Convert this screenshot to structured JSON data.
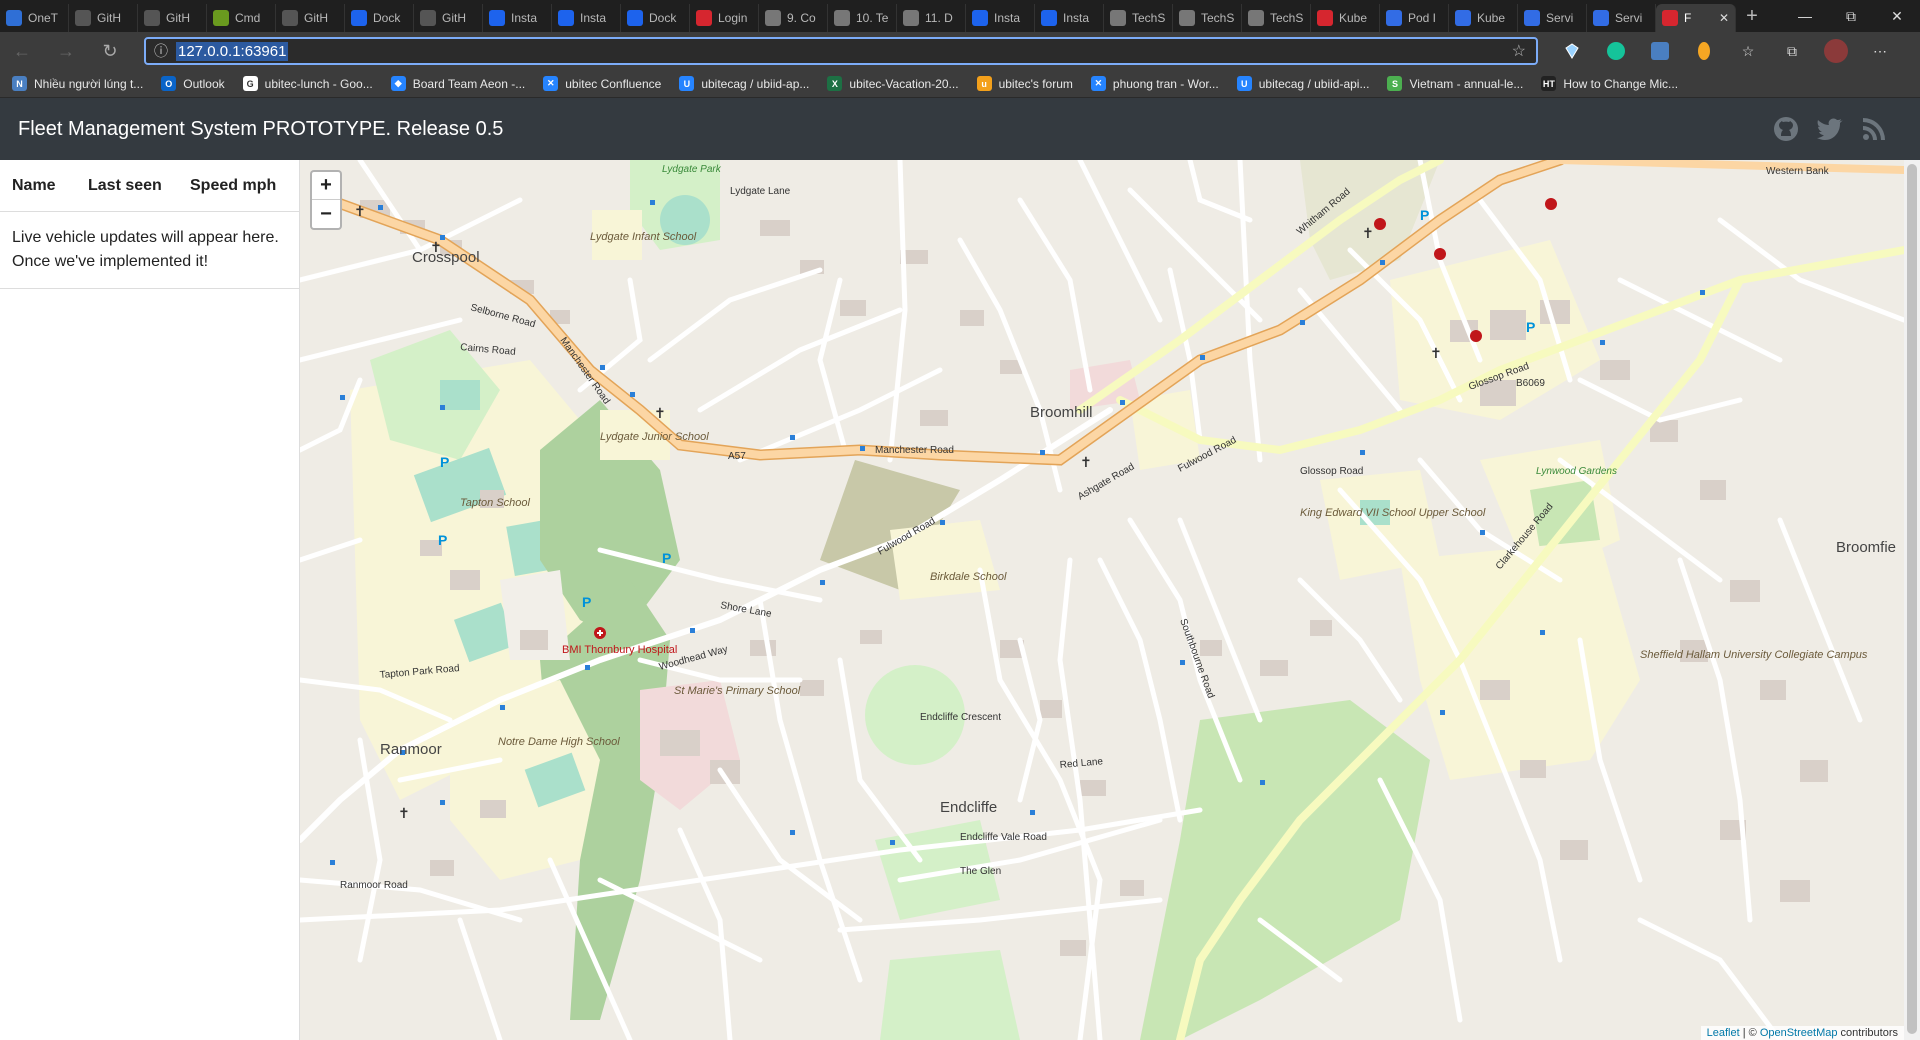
{
  "browser": {
    "tabs": [
      {
        "label": "OneT",
        "color": "#2f6fd6"
      },
      {
        "label": "GitH",
        "color": "#555555"
      },
      {
        "label": "GitH",
        "color": "#555555"
      },
      {
        "label": "Cmd",
        "color": "#6a9a1f"
      },
      {
        "label": "GitH",
        "color": "#555555"
      },
      {
        "label": "Dock",
        "color": "#1d63ed"
      },
      {
        "label": "GitH",
        "color": "#555555"
      },
      {
        "label": "Insta",
        "color": "#1d63ed"
      },
      {
        "label": "Insta",
        "color": "#1d63ed"
      },
      {
        "label": "Dock",
        "color": "#1d63ed"
      },
      {
        "label": "Login",
        "color": "#d6262f"
      },
      {
        "label": "9. Co",
        "color": "#777777"
      },
      {
        "label": "10. Te",
        "color": "#777777"
      },
      {
        "label": "11. D",
        "color": "#777777"
      },
      {
        "label": "Insta",
        "color": "#1d63ed"
      },
      {
        "label": "Insta",
        "color": "#1d63ed"
      },
      {
        "label": "TechS",
        "color": "#777777"
      },
      {
        "label": "TechS",
        "color": "#777777"
      },
      {
        "label": "TechS",
        "color": "#777777"
      },
      {
        "label": "Kube",
        "color": "#d6262f"
      },
      {
        "label": "Pod I",
        "color": "#326ce5"
      },
      {
        "label": "Kube",
        "color": "#326ce5"
      },
      {
        "label": "Servi",
        "color": "#326ce5"
      },
      {
        "label": "Servi",
        "color": "#326ce5"
      }
    ],
    "active_tab": {
      "label": "F",
      "color": "#d6262f"
    },
    "new_tab_label": "+",
    "url": "127.0.0.1:63961",
    "bookmarks": [
      {
        "label": "Nhiều người lúng t...",
        "color": "#4a7fc1",
        "glyph": "N"
      },
      {
        "label": "Outlook",
        "color": "#0a64c8",
        "glyph": "O"
      },
      {
        "label": "ubitec-lunch - Goo...",
        "color": "#ffffff",
        "glyph": "G"
      },
      {
        "label": "Board Team Aeon -...",
        "color": "#2684ff",
        "glyph": "◆"
      },
      {
        "label": "ubitec Confluence",
        "color": "#2684ff",
        "glyph": "✕"
      },
      {
        "label": "ubitecag / ubiid-ap...",
        "color": "#2684ff",
        "glyph": "U"
      },
      {
        "label": "ubitec-Vacation-20...",
        "color": "#1d7044",
        "glyph": "X"
      },
      {
        "label": "ubitec's forum",
        "color": "#f3a01b",
        "glyph": "u"
      },
      {
        "label": "phuong tran - Wor...",
        "color": "#2684ff",
        "glyph": "✕"
      },
      {
        "label": "ubitecag / ubiid-api...",
        "color": "#2684ff",
        "glyph": "U"
      },
      {
        "label": "Vietnam - annual-le...",
        "color": "#4caf50",
        "glyph": "S"
      },
      {
        "label": "How to Change Mic...",
        "color": "#222222",
        "glyph": "HT"
      }
    ]
  },
  "app": {
    "title": "Fleet Management System PROTOTYPE. Release 0.5",
    "table": {
      "headers": [
        "Name",
        "Last seen",
        "Speed mph"
      ],
      "placeholder": "Live vehicle updates will appear here. Once we've implemented it!"
    },
    "map": {
      "zoom_in": "+",
      "zoom_out": "−",
      "attribution_leaflet": "Leaflet",
      "attribution_sep": " | © ",
      "attribution_osm": "OpenStreetMap",
      "attribution_suffix": " contributors",
      "labels": {
        "crosspool": "Crosspool",
        "broomhill": "Broomhill",
        "ranmoor": "Ranmoor",
        "endcliffe": "Endcliffe",
        "broomfie": "Broomfie",
        "manchester_road": "Manchester Road",
        "manchester_road2": "Manchester Road",
        "a57": "A57",
        "fulwood_road": "Fulwood Road",
        "fulwood_road2": "Fulwood Road",
        "glossop_road": "Glossop Road",
        "glossop_road2": "Glossop Road",
        "clarkehouse_road": "Clarkehouse Road",
        "whitham_road": "Whitham Road",
        "b6069": "B6069",
        "lydgate_lane": "Lydgate Lane",
        "tapton_school": "Tapton School",
        "lydgate_junior": "Lydgate Junior School",
        "lydgate_infant": "Lydgate Infant School",
        "notre_dame": "Notre Dame High School",
        "birkdale": "Birkdale School",
        "st_maries": "St Marie's Primary School",
        "king_edward": "King Edward VII School Upper School",
        "sheffield_hallam": "Sheffield Hallam University Collegiate Campus",
        "bmi": "BMI Thornbury Hospital",
        "lydgate_park": "Lydgate Park",
        "lynwood": "Lynwood Gardens",
        "endcliffe_crescent": "Endcliffe Crescent",
        "endcliffe_vale": "Endcliffe Vale Road",
        "southbourne": "Southbourne Road",
        "ashgate": "Ashgate Road",
        "shore_lane": "Shore Lane",
        "woodhead_way": "Woodhead Way",
        "tapton_park": "Tapton Park Road",
        "selborne": "Selborne Road",
        "cairns": "Cairns Road",
        "red_lane": "Red Lane",
        "the_glen": "The Glen",
        "ranmoor_road": "Ranmoor Road",
        "western_bank": "Western Bank"
      }
    }
  }
}
